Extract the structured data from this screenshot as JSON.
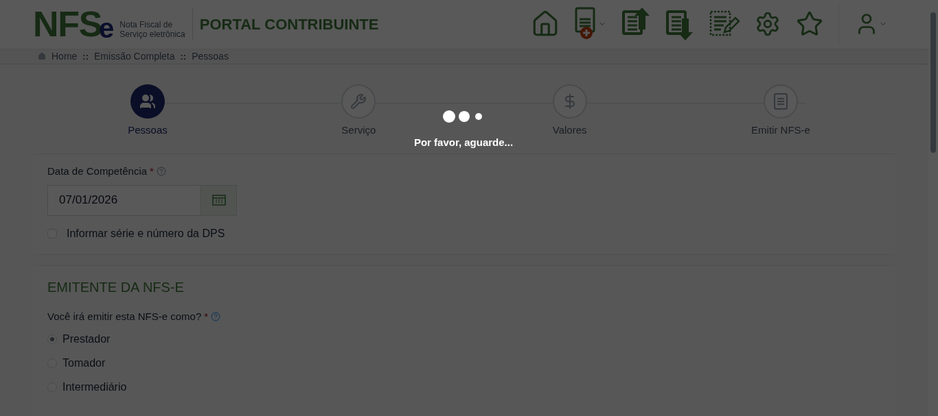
{
  "header": {
    "logo": {
      "letters": "NFS",
      "suffix": "e",
      "tagline": [
        "Nota Fiscal de",
        "Serviço eletrônica"
      ]
    },
    "title": "PORTAL CONTRIBUINTE"
  },
  "breadcrumb": {
    "separator": "::",
    "items": [
      "Home",
      "Emissão Completa",
      "Pessoas"
    ]
  },
  "steps": [
    {
      "label": "Pessoas",
      "kind": "people",
      "selected": true
    },
    {
      "label": "Serviço",
      "kind": "wrench",
      "selected": false
    },
    {
      "label": "Valores",
      "kind": "dollar",
      "selected": false
    },
    {
      "label": "Emitir NFS-e",
      "kind": "document",
      "selected": false
    }
  ],
  "loading": {
    "message": "Por favor, aguarde..."
  },
  "competencia": {
    "label": "Data de Competência",
    "required_mark": "*",
    "value": "07/01/2026"
  },
  "serie_checkbox": {
    "label": "Informar série e número da DPS",
    "checked": false
  },
  "emitente": {
    "heading": "EMITENTE DA NFS-E",
    "question": "Você irá emitir esta NFS-e como?",
    "required_mark": "*",
    "options": [
      {
        "label": "Prestador",
        "selected": true
      },
      {
        "label": "Tomador",
        "selected": false
      },
      {
        "label": "Intermediário",
        "selected": false
      }
    ]
  }
}
